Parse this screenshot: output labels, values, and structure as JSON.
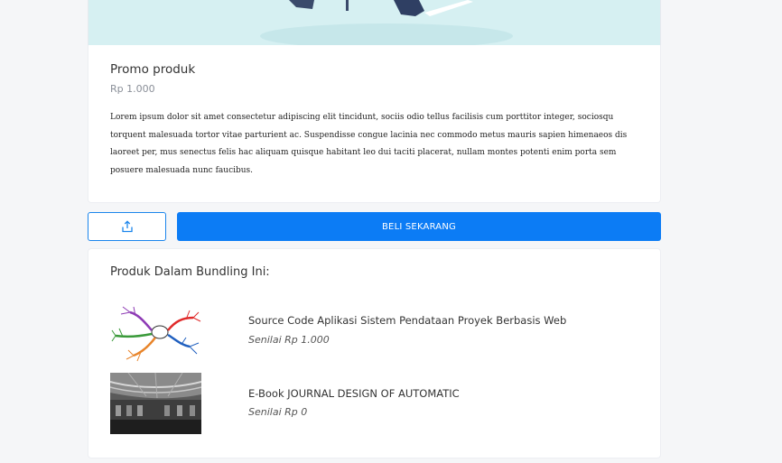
{
  "product": {
    "title": "Promo produk",
    "price": "Rp 1.000",
    "description": "Lorem ipsum dolor sit amet consectetur adipiscing elit tincidunt, sociis odio tellus facilisis cum porttitor integer, sociosqu torquent malesuada tortor vitae parturient ac. Suspendisse congue lacinia nec commodo metus mauris sapien himenaeos dis laoreet per, mus senectus felis hac aliquam quisque habitant leo dui taciti placerat, nullam montes potenti enim porta sem posuere malesuada nunc faucibus."
  },
  "actions": {
    "share_icon": "share-icon",
    "buy_label": "BELI SEKARANG"
  },
  "bundle": {
    "heading": "Produk Dalam Bundling Ini:",
    "items": [
      {
        "name": "Source Code Aplikasi Sistem Pendataan Proyek Berbasis Web",
        "value": "Senilai Rp 1.000",
        "thumb": "mind-map-image"
      },
      {
        "name": "E-Book JOURNAL DESIGN OF AUTOMATIC",
        "value": "Senilai Rp 0",
        "thumb": "building-photo"
      }
    ]
  },
  "colors": {
    "accent": "#0c7cf5",
    "background": "#f5f6f8",
    "hero": "#d3eef1"
  }
}
